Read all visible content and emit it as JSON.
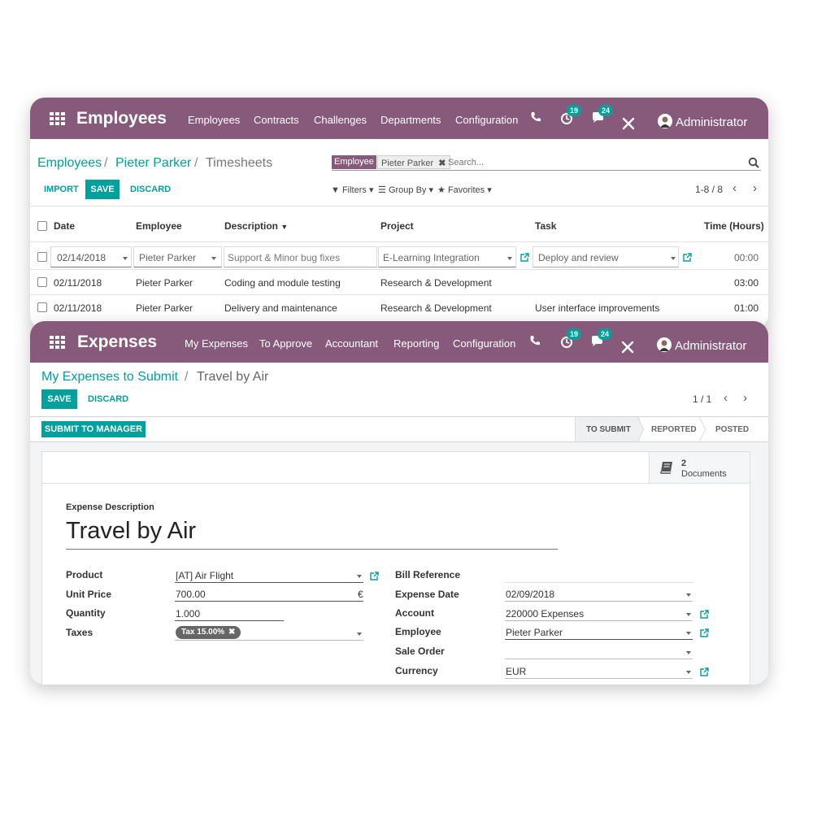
{
  "timesheets": {
    "navbar": {
      "app_name": "Employees",
      "menu": [
        "Employees",
        "Contracts",
        "Challenges",
        "Departments",
        "Configuration"
      ],
      "activity_count": "19",
      "message_count": "24",
      "user": "Administrator"
    },
    "breadcrumb": {
      "item1": "Employees",
      "item2": "Pieter Parker",
      "current": "Timesheets"
    },
    "search": {
      "facet_label": "Employee",
      "facet_value": "Pieter Parker",
      "placeholder": "Search..."
    },
    "buttons": {
      "import": "IMPORT",
      "save": "SAVE",
      "discard": "DISCARD"
    },
    "filters": {
      "filters": "Filters",
      "group_by": "Group By",
      "favorites": "Favorites"
    },
    "pager": "1-8 / 8",
    "columns": [
      "Date",
      "Employee",
      "Description",
      "Project",
      "Task",
      "Time (Hours)"
    ],
    "rows": [
      [
        "02/14/2018",
        "Pieter Parker",
        "Support & Minor bug fixes",
        "E-Learning Integration",
        "Deploy and review",
        "00:00"
      ],
      [
        "02/11/2018",
        "Pieter Parker",
        "Coding and module testing",
        "Research & Development",
        "",
        "03:00"
      ],
      [
        "02/11/2018",
        "Pieter Parker",
        "Delivery and maintenance",
        "Research & Development",
        "User interface improvements",
        "01:00"
      ]
    ]
  },
  "expenses": {
    "navbar": {
      "app_name": "Expenses",
      "menu": [
        "My Expenses",
        "To Approve",
        "Accountant",
        "Reporting",
        "Configuration"
      ],
      "activity_count": "19",
      "message_count": "24",
      "user": "Administrator"
    },
    "breadcrumb": {
      "parent": "My Expenses to Submit",
      "current": "Travel by Air"
    },
    "buttons": {
      "save": "SAVE",
      "discard": "DISCARD",
      "submit": "SUBMIT TO MANAGER"
    },
    "pager": "1 / 1",
    "stages": [
      "TO SUBMIT",
      "REPORTED",
      "POSTED"
    ],
    "documents": {
      "count": "2",
      "label": "Documents"
    },
    "form": {
      "description_label": "Expense Description",
      "title": "Travel by Air",
      "left": {
        "product_label": "Product",
        "product": "[AT] Air Flight",
        "unit_price_label": "Unit Price",
        "unit_price": "700.00",
        "currency_symbol": "€",
        "quantity_label": "Quantity",
        "quantity": "1.000",
        "taxes_label": "Taxes",
        "tax_tag": "Tax 15.00%"
      },
      "right": {
        "bill_ref_label": "Bill Reference",
        "bill_ref": "",
        "expense_date_label": "Expense Date",
        "expense_date": "02/09/2018",
        "account_label": "Account",
        "account": "220000 Expenses",
        "employee_label": "Employee",
        "employee": "Pieter Parker",
        "sale_order_label": "Sale Order",
        "sale_order": "",
        "currency_label": "Currency",
        "currency": "EUR"
      }
    }
  },
  "colors": {
    "brand": "#875a7b",
    "accent": "#00a09d"
  }
}
